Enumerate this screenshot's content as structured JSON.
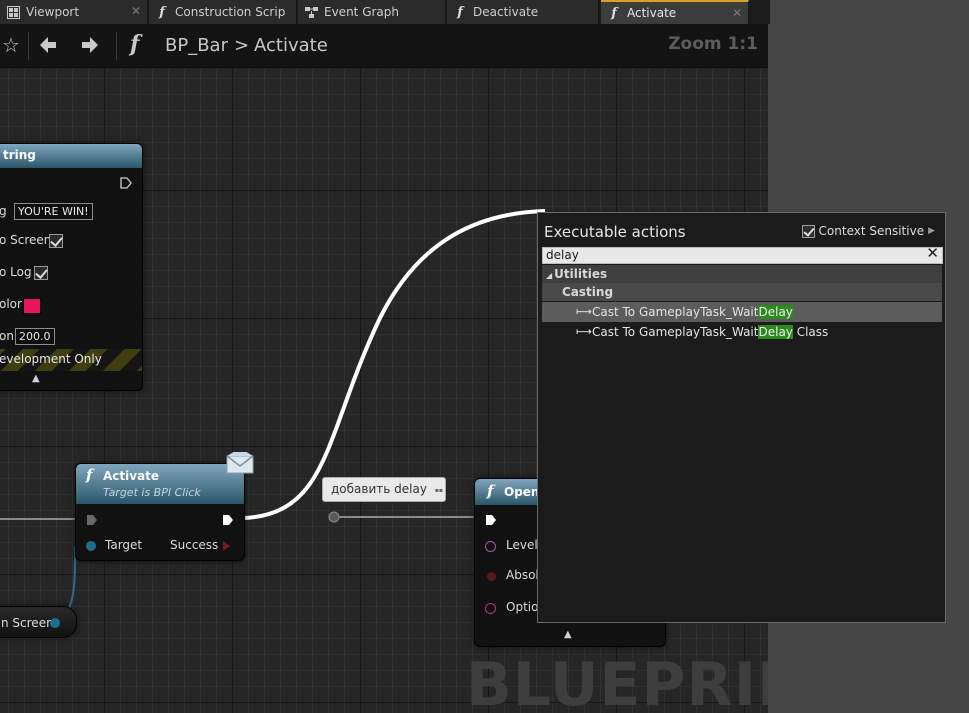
{
  "tabs": [
    {
      "label": "Viewport",
      "icon": "viewport-icon",
      "active": false
    },
    {
      "label": "Construction Scrip",
      "icon": "function-icon",
      "active": false
    },
    {
      "label": "Event Graph",
      "icon": "event-graph-icon",
      "active": false
    },
    {
      "label": "Deactivate",
      "icon": "function-icon",
      "active": false
    },
    {
      "label": "Activate",
      "icon": "function-icon",
      "active": true
    }
  ],
  "toolbar": {
    "breadcrumb_root": "BP_Bar",
    "breadcrumb_separator": ">",
    "breadcrumb_current": "Activate",
    "zoom": "Zoom 1:1"
  },
  "print_node": {
    "title_fragment": "tring",
    "in_string_label_fragment": "g",
    "in_string_value": "YOU'RE WIN!",
    "print_to_screen_label": "o Screen",
    "print_to_log_label": "o Log",
    "text_color_label": "olor",
    "text_color": "#e8155d",
    "duration_label": "on",
    "duration_value": "200.0",
    "dev_only_label": "evelopment Only"
  },
  "activate_node": {
    "title": "Activate",
    "subtitle": "Target is BPI Click",
    "target_label": "Target",
    "success_label": "Success"
  },
  "screen_node": {
    "label": "n Screen"
  },
  "open_node": {
    "title": "Open",
    "pin_level": "Level",
    "pin_absolute": "Absol",
    "pin_options": "Optio"
  },
  "tooltip": {
    "text": "добавить delay"
  },
  "popup": {
    "title": "Executable actions",
    "context_sensitive": "Context Sensitive",
    "search_value": "delay",
    "category_utilities": "Utilities",
    "category_casting": "Casting",
    "items": [
      {
        "prefix": "Cast To GameplayTask_Wait",
        "match": "Delay",
        "suffix": ""
      },
      {
        "prefix": "Cast To GameplayTask_Wait",
        "match": "Delay",
        "suffix": " Class"
      }
    ]
  },
  "watermark": "BLUEPRINT"
}
